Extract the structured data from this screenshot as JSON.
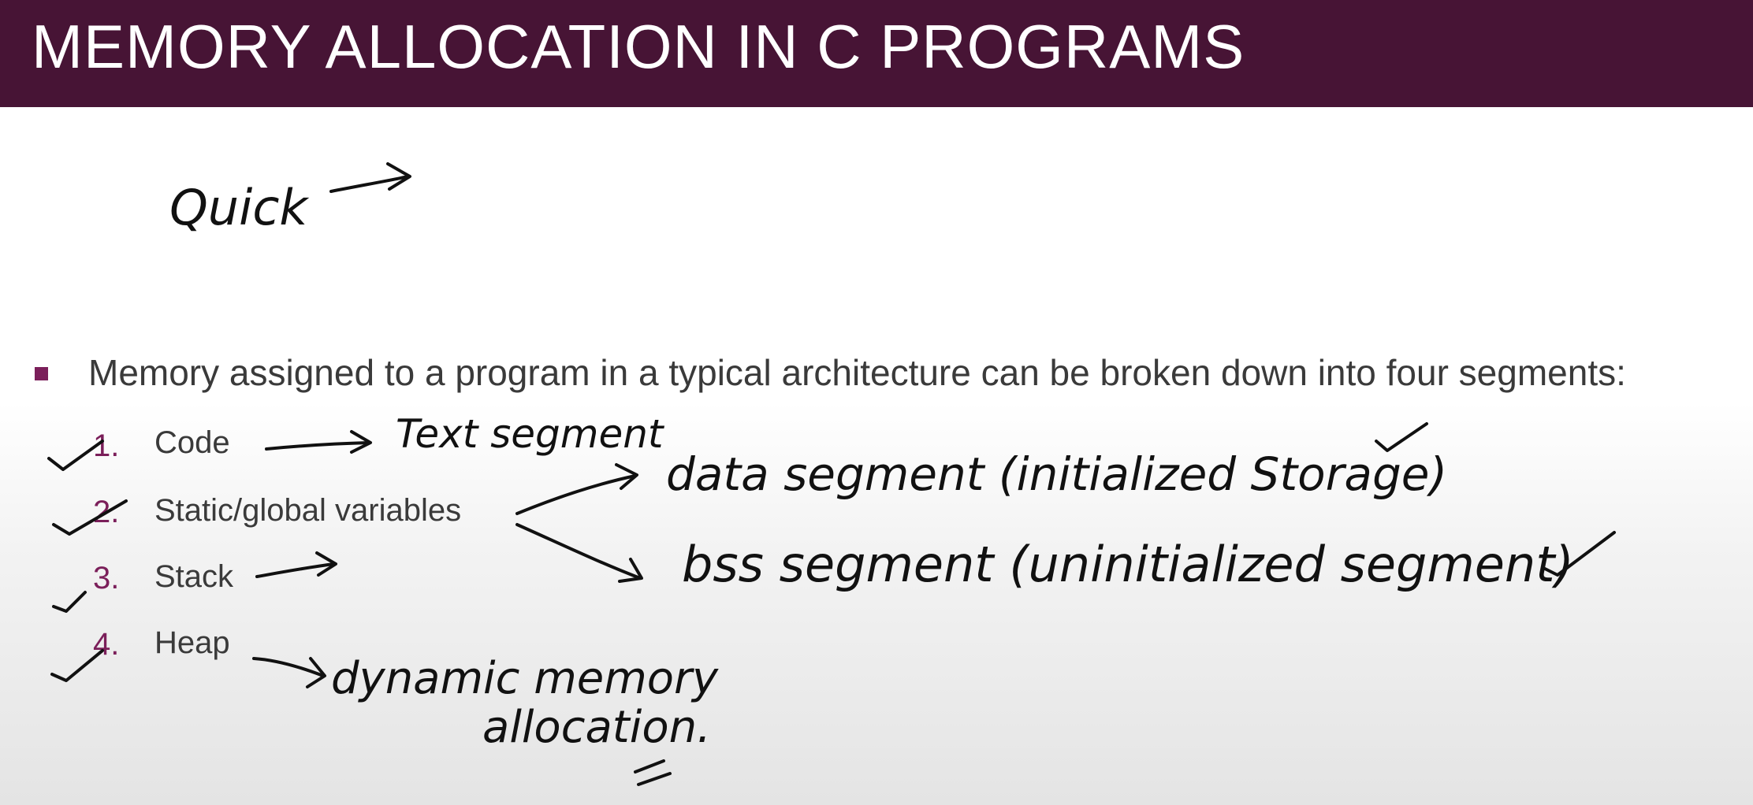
{
  "slide": {
    "title": "MEMORY ALLOCATION IN C PROGRAMS",
    "bullet": "Memory assigned to a program in a typical architecture can be broken down into four segments:",
    "items": [
      {
        "num": "1.",
        "label": "Code"
      },
      {
        "num": "2.",
        "label": "Static/global variables"
      },
      {
        "num": "3.",
        "label": "Stack"
      },
      {
        "num": "4.",
        "label": "Heap"
      }
    ]
  },
  "annotations": {
    "quick": "Quick",
    "text_segment": "Text segment",
    "data_segment": "data segment (initialized Storage)",
    "bss_segment": "bss segment (uninitialized segment)",
    "heap_note_line1": "dynamic memory",
    "heap_note_line2": "allocation."
  },
  "colors": {
    "title_bar": "#471435",
    "accent": "#7b1f5a"
  }
}
